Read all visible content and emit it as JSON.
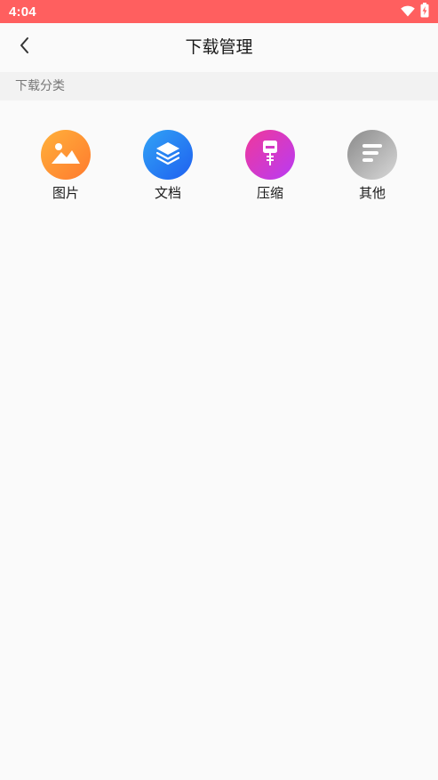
{
  "status_bar": {
    "time": "4:04",
    "icons": [
      "wifi-icon",
      "battery-charging-icon"
    ]
  },
  "header": {
    "title": "下载管理",
    "back_icon": "chevron-left-icon"
  },
  "section": {
    "title": "下载分类"
  },
  "categories": [
    {
      "label": "图片",
      "icon": "image-icon",
      "colors": [
        "#ffb13b",
        "#ff7a2e"
      ]
    },
    {
      "label": "文档",
      "icon": "layers-icon",
      "colors": [
        "#31a3f5",
        "#1f60f0"
      ]
    },
    {
      "label": "压缩",
      "icon": "zip-icon",
      "colors": [
        "#f0389a",
        "#b83bf5"
      ]
    },
    {
      "label": "其他",
      "icon": "lines-icon",
      "colors": [
        "#8a8a8a",
        "#d8d8d8"
      ]
    }
  ],
  "colors": {
    "status_bar": "#ff5f5f",
    "background": "#fafafa",
    "section_bg": "#f2f2f2"
  }
}
